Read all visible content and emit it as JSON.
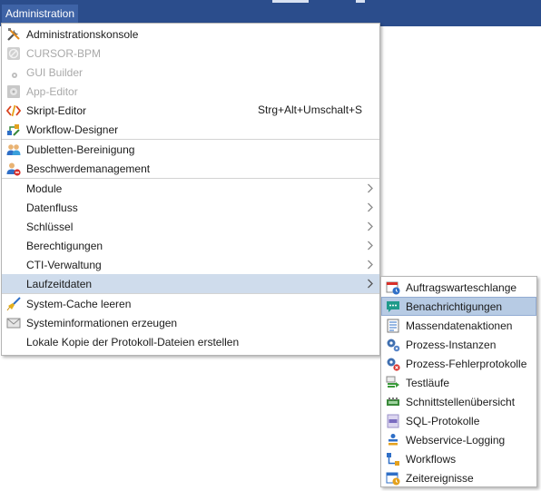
{
  "menubar": {
    "title": "Administration"
  },
  "main_menu": {
    "items": [
      {
        "label": "Administrationskonsole",
        "icon": "tools-icon"
      },
      {
        "label": "CURSOR-BPM",
        "icon": "bpm-icon",
        "disabled": true
      },
      {
        "label": "GUI Builder",
        "icon": "gui-builder-icon",
        "disabled": true
      },
      {
        "label": "App-Editor",
        "icon": "app-editor-icon",
        "disabled": true
      },
      {
        "label": "Skript-Editor",
        "icon": "script-icon",
        "shortcut": "Strg+Alt+Umschalt+S"
      },
      {
        "label": "Workflow-Designer",
        "icon": "workflow-designer-icon"
      },
      {
        "label": "Dubletten-Bereinigung",
        "icon": "users-icon"
      },
      {
        "label": "Beschwerdemanagement",
        "icon": "complaint-user-icon"
      },
      {
        "label": "Module"
      },
      {
        "label": "Datenfluss"
      },
      {
        "label": "Schlüssel"
      },
      {
        "label": "Berechtigungen"
      },
      {
        "label": "CTI-Verwaltung"
      },
      {
        "label": "Laufzeitdaten"
      },
      {
        "label": "System-Cache leeren",
        "icon": "broom-icon"
      },
      {
        "label": "Systeminformationen erzeugen",
        "icon": "envelope-icon"
      },
      {
        "label": "Lokale Kopie der Protokoll-Dateien erstellen"
      }
    ]
  },
  "sub_menu": {
    "items": [
      {
        "label": "Auftragswarteschlange",
        "icon": "calendar-clock-icon"
      },
      {
        "label": "Benachrichtigungen",
        "icon": "chat-bubble-icon"
      },
      {
        "label": "Massendatenaktionen",
        "icon": "checklist-icon"
      },
      {
        "label": "Prozess-Instanzen",
        "icon": "gears-icon"
      },
      {
        "label": "Prozess-Fehlerprotokolle",
        "icon": "gear-error-icon"
      },
      {
        "label": "Testläufe",
        "icon": "test-run-icon"
      },
      {
        "label": "Schnittstellenübersicht",
        "icon": "interface-icon"
      },
      {
        "label": "SQL-Protokolle",
        "icon": "sql-icon"
      },
      {
        "label": "Webservice-Logging",
        "icon": "webservice-icon"
      },
      {
        "label": "Workflows",
        "icon": "workflow-icon"
      },
      {
        "label": "Zeitereignisse",
        "icon": "time-event-icon"
      }
    ]
  },
  "colors": {
    "topbar": "#2b4d8c",
    "highlight": "#cfdcec",
    "highlight_sub": "#b7cbe4",
    "disabled_text": "#a9a9a9"
  }
}
